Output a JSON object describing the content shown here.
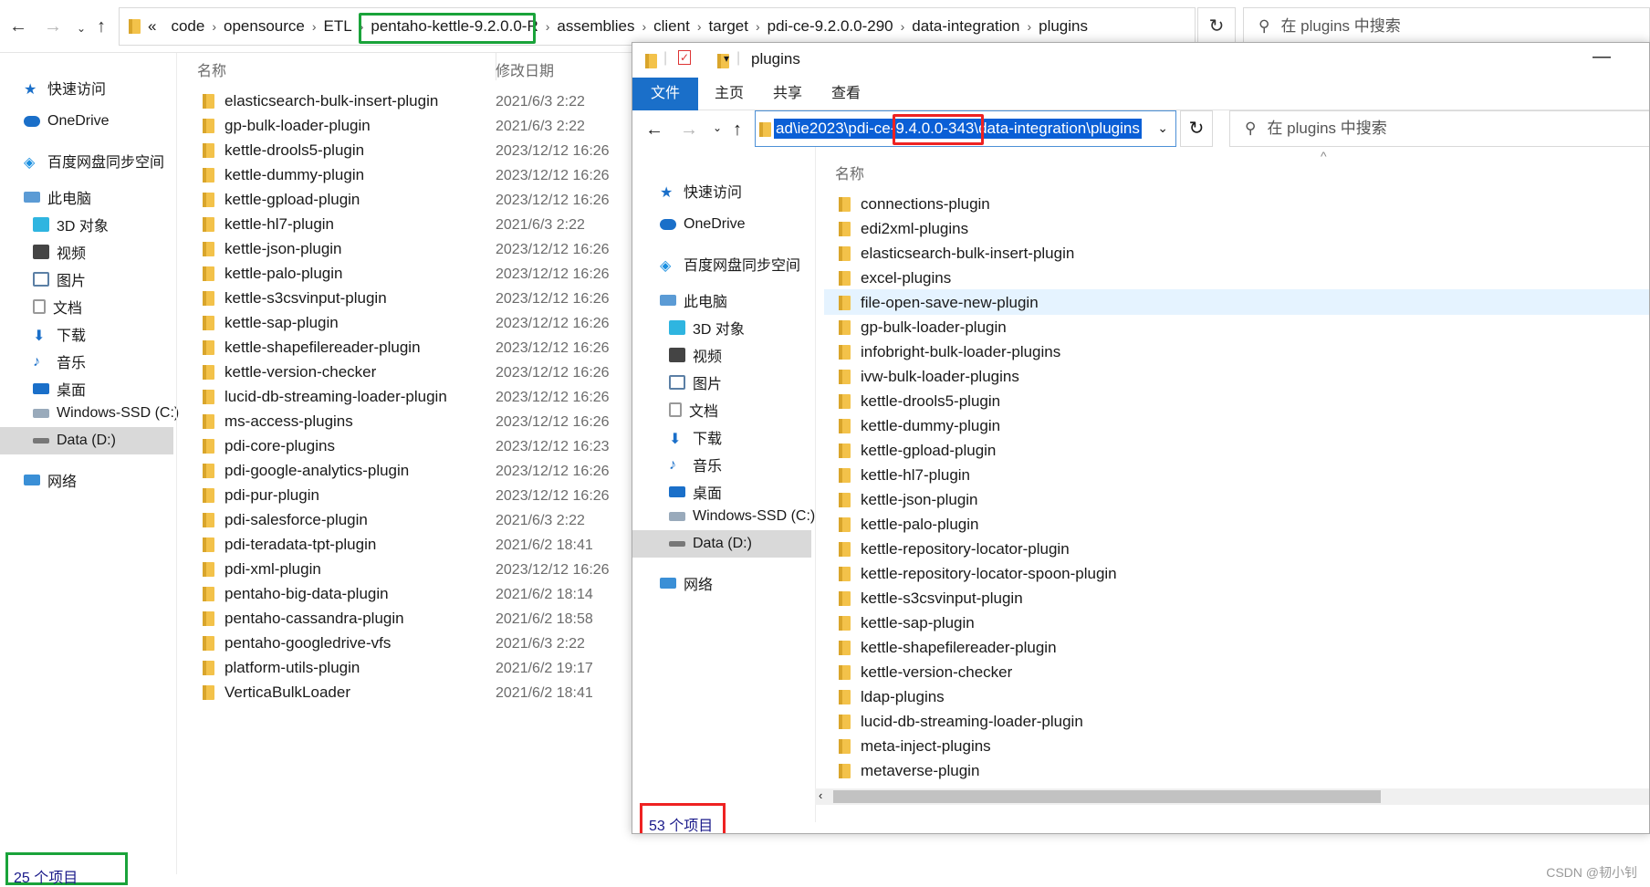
{
  "back_window": {
    "path_crumbs": [
      "«",
      "code",
      "opensource",
      "ETL",
      "pentaho-kettle-9.2.0.0-R",
      "assemblies",
      "client",
      "target",
      "pdi-ce-9.2.0.0-290",
      "data-integration",
      "plugins"
    ],
    "search_placeholder": "在 plugins 中搜索",
    "sidebar": {
      "quick_access": "快速访问",
      "onedrive": "OneDrive",
      "baidu": "百度网盘同步空间",
      "this_pc": "此电脑",
      "objects3d": "3D 对象",
      "video": "视频",
      "pictures": "图片",
      "documents": "文档",
      "downloads": "下载",
      "music": "音乐",
      "desktop": "桌面",
      "drive_c": "Windows-SSD (C:)",
      "drive_d": "Data (D:)",
      "network": "网络"
    },
    "col_name": "名称",
    "col_date": "修改日期",
    "files": [
      {
        "name": "elasticsearch-bulk-insert-plugin",
        "date": "2021/6/3 2:22"
      },
      {
        "name": "gp-bulk-loader-plugin",
        "date": "2021/6/3 2:22"
      },
      {
        "name": "kettle-drools5-plugin",
        "date": "2023/12/12 16:26"
      },
      {
        "name": "kettle-dummy-plugin",
        "date": "2023/12/12 16:26"
      },
      {
        "name": "kettle-gpload-plugin",
        "date": "2023/12/12 16:26"
      },
      {
        "name": "kettle-hl7-plugin",
        "date": "2021/6/3 2:22"
      },
      {
        "name": "kettle-json-plugin",
        "date": "2023/12/12 16:26"
      },
      {
        "name": "kettle-palo-plugin",
        "date": "2023/12/12 16:26"
      },
      {
        "name": "kettle-s3csvinput-plugin",
        "date": "2023/12/12 16:26"
      },
      {
        "name": "kettle-sap-plugin",
        "date": "2023/12/12 16:26"
      },
      {
        "name": "kettle-shapefilereader-plugin",
        "date": "2023/12/12 16:26"
      },
      {
        "name": "kettle-version-checker",
        "date": "2023/12/12 16:26"
      },
      {
        "name": "lucid-db-streaming-loader-plugin",
        "date": "2023/12/12 16:26"
      },
      {
        "name": "ms-access-plugins",
        "date": "2023/12/12 16:26"
      },
      {
        "name": "pdi-core-plugins",
        "date": "2023/12/12 16:23"
      },
      {
        "name": "pdi-google-analytics-plugin",
        "date": "2023/12/12 16:26"
      },
      {
        "name": "pdi-pur-plugin",
        "date": "2023/12/12 16:26"
      },
      {
        "name": "pdi-salesforce-plugin",
        "date": "2021/6/3 2:22"
      },
      {
        "name": "pdi-teradata-tpt-plugin",
        "date": "2021/6/2 18:41"
      },
      {
        "name": "pdi-xml-plugin",
        "date": "2023/12/12 16:26"
      },
      {
        "name": "pentaho-big-data-plugin",
        "date": "2021/6/2 18:14"
      },
      {
        "name": "pentaho-cassandra-plugin",
        "date": "2021/6/2 18:58"
      },
      {
        "name": "pentaho-googledrive-vfs",
        "date": "2021/6/3 2:22"
      },
      {
        "name": "platform-utils-plugin",
        "date": "2021/6/2 19:17"
      },
      {
        "name": "VerticaBulkLoader",
        "date": "2021/6/2 18:41"
      }
    ],
    "status": "25 个项目"
  },
  "front_window": {
    "title": "plugins",
    "ribbon_tabs": [
      "文件",
      "主页",
      "共享",
      "查看"
    ],
    "address": "ad\\ie2023\\pdi-ce-9.4.0.0-343\\data-integration\\plugins",
    "search_placeholder": "在 plugins 中搜索",
    "col_name": "名称",
    "files": [
      "connections-plugin",
      "edi2xml-plugins",
      "elasticsearch-bulk-insert-plugin",
      "excel-plugins",
      "file-open-save-new-plugin",
      "gp-bulk-loader-plugin",
      "infobright-bulk-loader-plugins",
      "ivw-bulk-loader-plugins",
      "kettle-drools5-plugin",
      "kettle-dummy-plugin",
      "kettle-gpload-plugin",
      "kettle-hl7-plugin",
      "kettle-json-plugin",
      "kettle-palo-plugin",
      "kettle-repository-locator-plugin",
      "kettle-repository-locator-spoon-plugin",
      "kettle-s3csvinput-plugin",
      "kettle-sap-plugin",
      "kettle-shapefilereader-plugin",
      "kettle-version-checker",
      "ldap-plugins",
      "lucid-db-streaming-loader-plugin",
      "meta-inject-plugins",
      "metaverse-plugin"
    ],
    "status": "53 个项目"
  },
  "watermark": "CSDN @韧小钊",
  "colors": {
    "green_highlight": "#1aa33a",
    "red_highlight": "#e22222",
    "ribbon_active": "#1a6fc9",
    "folder": "#f3c24a",
    "selected_row": "#e5f3ff"
  }
}
